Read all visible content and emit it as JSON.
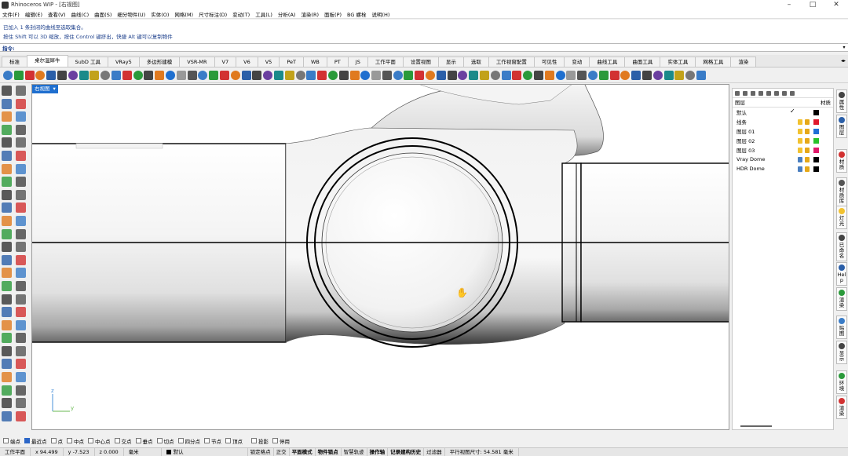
{
  "window": {
    "title": "Rhinoceros WIP - [右视图]",
    "min": "–",
    "max": "□",
    "close": "✕"
  },
  "menu": [
    "文件(F)",
    "编辑(E)",
    "查看(V)",
    "曲线(C)",
    "曲面(S)",
    "细分物件(U)",
    "实体(O)",
    "网格(M)",
    "尺寸标注(D)",
    "变动(T)",
    "工具(L)",
    "分析(A)",
    "渲染(R)",
    "面板(P)",
    "BG 螺栓",
    "说明(H)"
  ],
  "command_history": [
    "已加入 1 条封闭的曲线至选取集合。",
    "按住 Shift 可以 3D 缩放，按住 Control 键挤出，快捷 Alt 键可以复制物件"
  ],
  "command_prompt": {
    "label": "指令:",
    "value": ""
  },
  "tabs": [
    "标准",
    "桌尔温犀牛",
    "SubD 工具",
    "VRay5",
    "多边形建模",
    "VSR-MR",
    "V7",
    "V6",
    "V5",
    "PeT",
    "WB",
    "PT",
    "JS",
    "工作平面",
    "设置视图",
    "显示",
    "选取",
    "工作视窗配置",
    "可见性",
    "变动",
    "曲线工具",
    "曲面工具",
    "实体工具",
    "网格工具",
    "渲染"
  ],
  "active_tab_index": 1,
  "viewport": {
    "label": "右视图",
    "menu_arrow": "▾",
    "cursor": "✋",
    "axis_z": "z",
    "axis_y": "y"
  },
  "layers_panel": {
    "header_name": "图层",
    "header_material": "材质",
    "layers": [
      {
        "name": "默认",
        "color": "#000000",
        "current": true
      },
      {
        "name": "线条",
        "color": "#e0182b"
      },
      {
        "name": "图层 01",
        "color": "#1f6fd6"
      },
      {
        "name": "图层 02",
        "color": "#28c32a"
      },
      {
        "name": "图层 03",
        "color": "#e0186a"
      },
      {
        "name": "Vray Dome",
        "color": "#000000"
      },
      {
        "name": "HDR Dome",
        "color": "#000000"
      }
    ]
  },
  "side_tabs": [
    "属性",
    "图层",
    "材质",
    "材质库",
    "灯光",
    "已命名",
    "Help",
    "渲染",
    "贴图",
    "显示",
    "环境",
    "渲染"
  ],
  "osnap": [
    {
      "label": "端点",
      "on": false
    },
    {
      "label": "最近点",
      "on": true
    },
    {
      "label": "点",
      "on": false
    },
    {
      "label": "中点",
      "on": false
    },
    {
      "label": "中心点",
      "on": false
    },
    {
      "label": "交点",
      "on": false
    },
    {
      "label": "垂点",
      "on": false
    },
    {
      "label": "切点",
      "on": false
    },
    {
      "label": "四分点",
      "on": false
    },
    {
      "label": "节点",
      "on": false
    },
    {
      "label": "顶点",
      "on": false
    },
    {
      "label": "投影",
      "on": false
    },
    {
      "label": "停用",
      "on": false
    }
  ],
  "status": {
    "cplane": "工作平面",
    "x": "x 94.499",
    "y": "y -7.523",
    "z": "z 0.000",
    "unit": "毫米",
    "layer": "默认",
    "modes": [
      "锁定格点",
      "正交",
      "平面模式",
      "物件锁点",
      "智慧轨迹",
      "操作轴",
      "记录建构历史",
      "过滤器"
    ],
    "bold_modes": [
      "平面模式",
      "物件锁点",
      "操作轴",
      "记录建构历史"
    ],
    "viewport_size": "平行视图尺寸: 54.581 毫米"
  },
  "colors": {
    "accent": "#1f6fcf"
  }
}
